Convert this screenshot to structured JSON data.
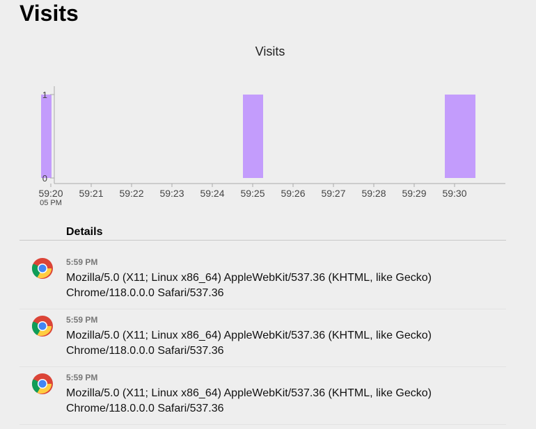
{
  "page": {
    "title": "Visits"
  },
  "chart_data": {
    "type": "bar",
    "title": "Visits",
    "categories": [
      "59:20",
      "59:21",
      "59:22",
      "59:23",
      "59:24",
      "59:25",
      "59:26",
      "59:27",
      "59:28",
      "59:29",
      "59:30"
    ],
    "x_sublabel": "05 PM",
    "bars": [
      {
        "x": "59:20",
        "value": 1
      },
      {
        "x": "59:25",
        "value": 1
      },
      {
        "x": "59:30",
        "value": 1
      }
    ],
    "yticks": [
      0,
      1
    ],
    "ylim": [
      0,
      1
    ],
    "colors": {
      "bar": "#c39cfc"
    }
  },
  "details": {
    "label": "Details",
    "items": [
      {
        "icon": "chrome-icon",
        "time": "5:59 PM",
        "user_agent": "Mozilla/5.0 (X11; Linux x86_64) AppleWebKit/537.36 (KHTML, like Gecko) Chrome/118.0.0.0 Safari/537.36"
      },
      {
        "icon": "chrome-icon",
        "time": "5:59 PM",
        "user_agent": "Mozilla/5.0 (X11; Linux x86_64) AppleWebKit/537.36 (KHTML, like Gecko) Chrome/118.0.0.0 Safari/537.36"
      },
      {
        "icon": "chrome-icon",
        "time": "5:59 PM",
        "user_agent": "Mozilla/5.0 (X11; Linux x86_64) AppleWebKit/537.36 (KHTML, like Gecko) Chrome/118.0.0.0 Safari/537.36"
      }
    ]
  }
}
